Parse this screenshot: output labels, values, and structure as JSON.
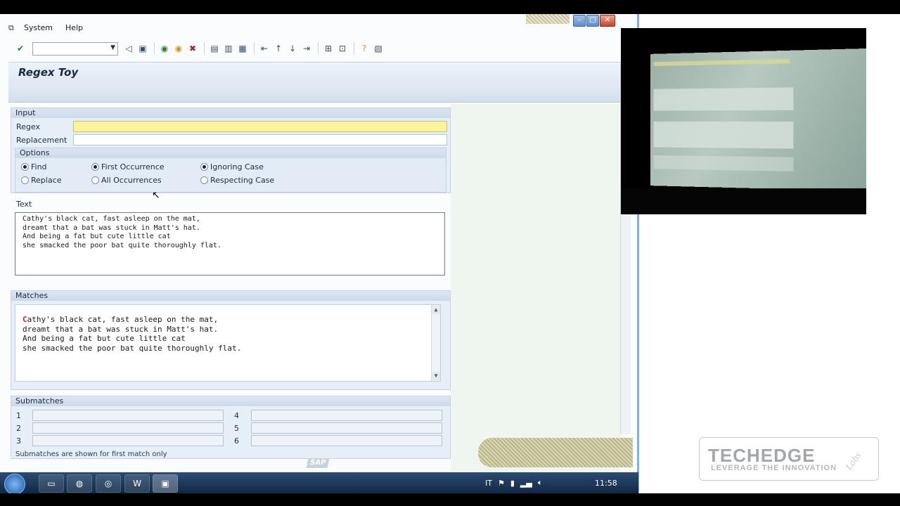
{
  "menubar": {
    "items": [
      "System",
      "Help"
    ]
  },
  "page_title": "Regex Toy",
  "input_group": {
    "title": "Input",
    "regex_label": "Regex",
    "regex_value": "",
    "replacement_label": "Replacement",
    "replacement_value": ""
  },
  "options": {
    "title": "Options",
    "find": "Find",
    "replace": "Replace",
    "first": "First Occurrence",
    "all": "All Occurrences",
    "ignoring": "Ignoring Case",
    "respecting": "Respecting Case"
  },
  "text": {
    "label": "Text",
    "lines": [
      "Cathy's black cat, fast asleep on the mat,",
      "dreamt that a bat was stuck in Matt's hat.",
      "And being a fat but cute little cat",
      "she smacked the poor bat quite thoroughly flat."
    ]
  },
  "matches": {
    "title": "Matches",
    "highlight": "C",
    "first_line_rest": "athy's black cat, fast asleep on the mat,",
    "lines": [
      "dreamt that a bat was stuck in Matt's hat.",
      "And being a fat but cute little cat",
      "she smacked the poor bat quite thoroughly flat."
    ]
  },
  "submatches": {
    "title": "Submatches",
    "nums": [
      "1",
      "2",
      "3",
      "4",
      "5",
      "6"
    ],
    "note": "Submatches are shown for first match only"
  },
  "sap_logo": "SAP",
  "taskbar": {
    "lang": "IT",
    "clock": "11:58",
    "word": "W"
  },
  "logo": {
    "main": "TECHEDGE",
    "tagline": "LEVERAGE THE INNOVATION",
    "labs": "Labs"
  },
  "colors": {
    "regex_field": "#fbf49a",
    "match_highlight": "#d21d1d",
    "group_bg": "#e6eef7"
  }
}
